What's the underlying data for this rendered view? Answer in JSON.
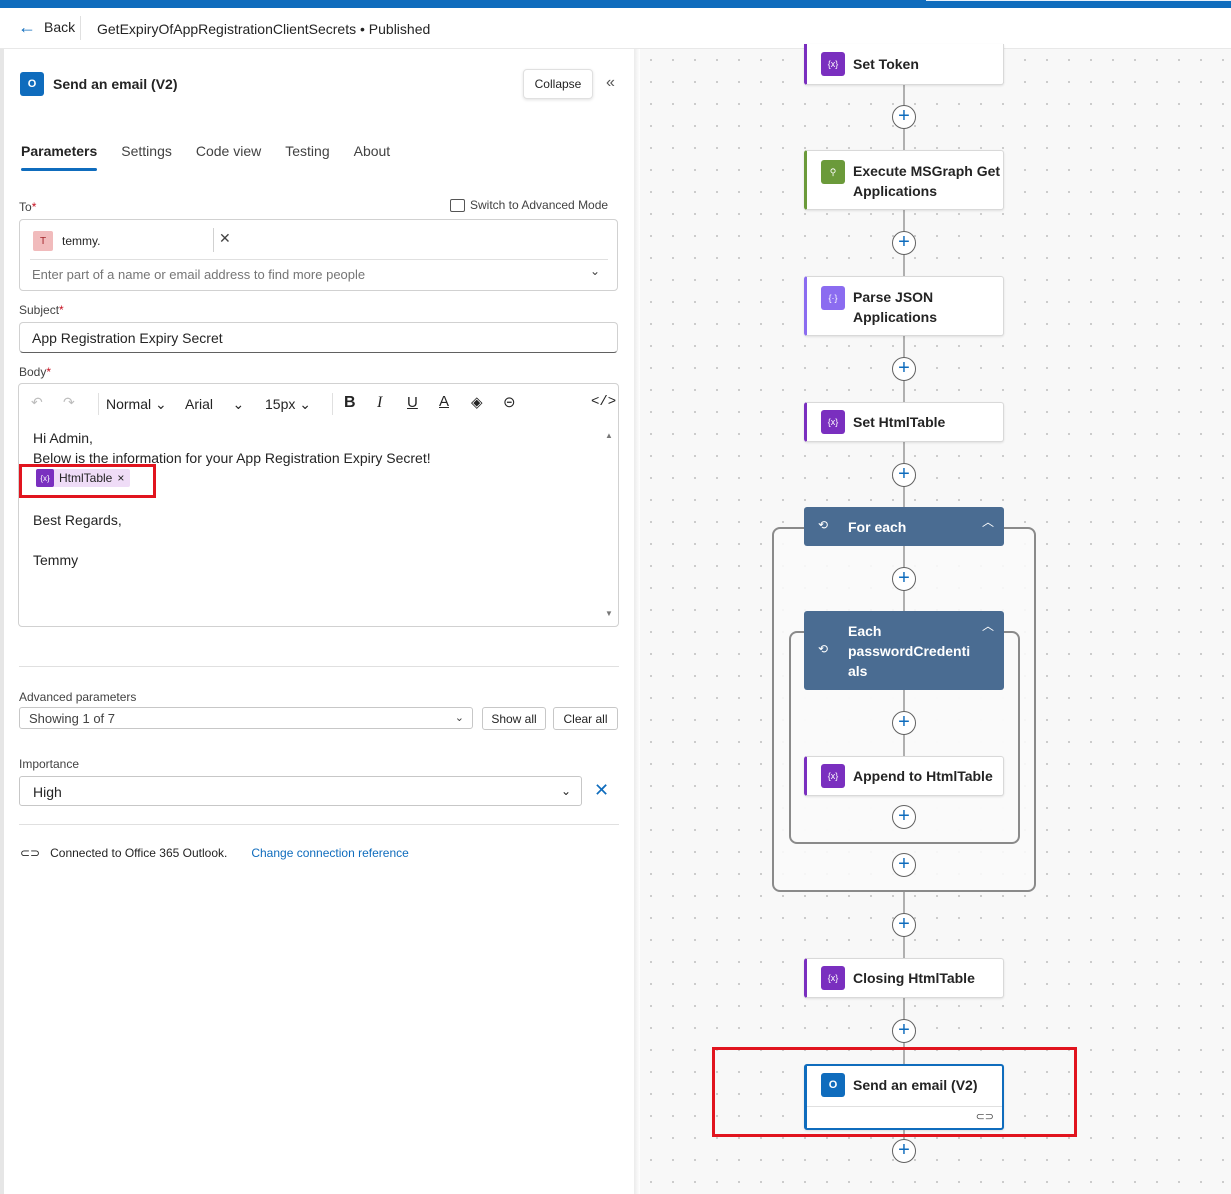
{
  "header": {
    "back_label": "Back",
    "flow_title": "GetExpiryOfAppRegistrationClientSecrets • Published"
  },
  "panel": {
    "action_icon": "outlook-icon",
    "action_title": "Send an email (V2)",
    "collapse_label": "Collapse",
    "tabs": [
      {
        "label": "Parameters",
        "active": true
      },
      {
        "label": "Settings"
      },
      {
        "label": "Code view"
      },
      {
        "label": "Testing"
      },
      {
        "label": "About"
      }
    ],
    "to": {
      "label": "To",
      "switch_advanced": "Switch to Advanced Mode",
      "recipient_initial": "T",
      "recipient": "temmy.",
      "placeholder": "Enter part of a name or email address to find more people"
    },
    "subject": {
      "label": "Subject",
      "value": "App Registration Expiry Secret"
    },
    "body": {
      "label": "Body",
      "toolbar": {
        "paragraph": "Normal",
        "font": "Arial",
        "size": "15px"
      },
      "line1": "Hi Admin,",
      "line2": "Below is the information for your App Registration Expiry Secret!",
      "token": "HtmlTable",
      "token_icon_text": "{x}",
      "line3": "Best Regards,",
      "line4": "Temmy"
    },
    "advanced": {
      "label": "Advanced parameters",
      "value": "Showing 1 of 7",
      "show_all": "Show all",
      "clear_all": "Clear all"
    },
    "importance": {
      "label": "Importance",
      "value": "High"
    },
    "connection": {
      "text": "Connected to Office 365 Outlook.",
      "change_link": "Change connection reference"
    }
  },
  "canvas": {
    "nodes": [
      {
        "id": "set-token",
        "label": "Set Token",
        "icon": "variable-icon",
        "color": "#7a2fbf"
      },
      {
        "id": "execute-msgraph",
        "label": "Execute MSGraph Get Applications",
        "icon": "http-icon",
        "color": "#6b9a3a"
      },
      {
        "id": "parse-json",
        "label": "Parse JSON Applications",
        "icon": "parse-json-icon",
        "color": "#8b6cf0"
      },
      {
        "id": "set-htmltable",
        "label": "Set HtmlTable",
        "icon": "variable-icon",
        "color": "#7a2fbf"
      },
      {
        "id": "for-each",
        "label": "For each",
        "icon": "loop-icon",
        "color": "#4a6c92"
      },
      {
        "id": "each-password",
        "label": "Each passwordCredentials",
        "icon": "loop-icon",
        "color": "#4a6c92"
      },
      {
        "id": "append-htmltable",
        "label": "Append to HtmlTable",
        "icon": "variable-icon",
        "color": "#7a2fbf"
      },
      {
        "id": "closing-htmltable",
        "label": "Closing HtmlTable",
        "icon": "variable-icon",
        "color": "#7a2fbf"
      },
      {
        "id": "send-email",
        "label": "Send an email (V2)",
        "icon": "outlook-icon",
        "color": "#0f6cbd",
        "selected": true
      }
    ],
    "each_label_lines": [
      "Each",
      "passwordCredenti",
      "als"
    ],
    "execute_label_lines": [
      "Execute MSGraph Get",
      "Applications"
    ],
    "parse_label_lines": [
      "Parse JSON",
      "Applications"
    ]
  },
  "colors": {
    "accent": "#0f6cbd",
    "highlight": "#e1141e",
    "variable": "#7a2fbf",
    "loop": "#4a6c92"
  }
}
